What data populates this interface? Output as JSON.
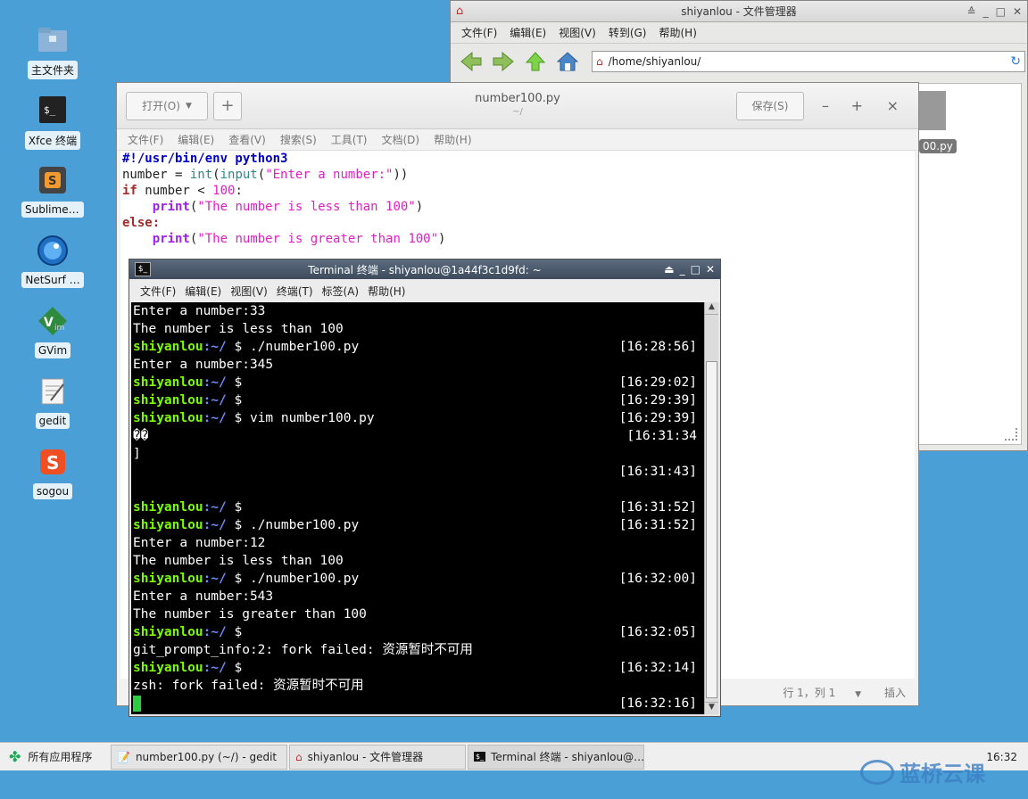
{
  "desktop": {
    "icons": [
      {
        "label": "主文件夹",
        "icon": "folder-icon"
      },
      {
        "label": "Xfce 终端",
        "icon": "terminal-icon"
      },
      {
        "label": "Sublime …",
        "icon": "sublime-icon"
      },
      {
        "label": "NetSurf …",
        "icon": "netsurf-icon"
      },
      {
        "label": "GVim",
        "icon": "gvim-icon"
      },
      {
        "label": "gedit",
        "icon": "gedit-icon"
      },
      {
        "label": "sogou",
        "icon": "sogou-icon"
      }
    ]
  },
  "file_manager": {
    "title": "shiyanlou - 文件管理器",
    "menu": [
      "文件(F)",
      "编辑(E)",
      "视图(V)",
      "转到(G)",
      "帮助(H)"
    ],
    "address": "/home/shiyanlou/",
    "partial_file_label": "00.py"
  },
  "gedit": {
    "open_label": "打开(O)",
    "new_label": "+",
    "title": "number100.py",
    "subtitle": "~/",
    "save_label": "保存(S)",
    "minimize": "–",
    "maximize": "+",
    "close": "×",
    "menu": [
      "文件(F)",
      "编辑(E)",
      "查看(V)",
      "搜索(S)",
      "工具(T)",
      "文档(D)",
      "帮助(H)"
    ],
    "code": {
      "l1": "#!/usr/bin/env python3",
      "l2_var": "number = ",
      "l2_int": "int",
      "l2_input": "input",
      "l2_str": "\"Enter a number:\"",
      "l3_if": "if",
      "l3_mid": " number < ",
      "l3_num": "100",
      "l4_print": "print",
      "l4_str": "\"The number is less than 100\"",
      "l5_else": "else",
      "l6_print": "print",
      "l6_str": "\"The number is greater than 100\""
    },
    "status_position": "行 1，列 1",
    "status_mode": "插入"
  },
  "terminal": {
    "title": "Terminal 终端 - shiyanlou@1a44f3c1d9fd: ~",
    "menu": [
      "文件(F)",
      "编辑(E)",
      "视图(V)",
      "终端(T)",
      "标签(A)",
      "帮助(H)"
    ],
    "user": "shiyanlou",
    "path": ":~/",
    "lines": [
      {
        "text": "Enter a number:33"
      },
      {
        "text": "The number is less than 100"
      },
      {
        "prompt": true,
        "cmd": " $ ./number100.py",
        "time": "[16:28:56]"
      },
      {
        "text": "Enter a number:345"
      },
      {
        "prompt": true,
        "cmd": " $",
        "time": "[16:29:02]"
      },
      {
        "prompt": true,
        "cmd": " $",
        "time": "[16:29:39]"
      },
      {
        "prompt": true,
        "cmd": " $ vim number100.py",
        "time": "[16:29:39]"
      },
      {
        "text": "��",
        "time": "[16:31:34"
      },
      {
        "text": "]"
      },
      {
        "text": "",
        "time": "[16:31:43]"
      },
      {
        "text": ""
      },
      {
        "prompt": true,
        "cmd": " $",
        "time": "[16:31:52]"
      },
      {
        "prompt": true,
        "cmd": " $ ./number100.py",
        "time": "[16:31:52]"
      },
      {
        "text": "Enter a number:12"
      },
      {
        "text": "The number is less than 100"
      },
      {
        "prompt": true,
        "cmd": " $ ./number100.py",
        "time": "[16:32:00]"
      },
      {
        "text": "Enter a number:543"
      },
      {
        "text": "The number is greater than 100"
      },
      {
        "prompt": true,
        "cmd": " $",
        "time": "[16:32:05]"
      },
      {
        "text": "git_prompt_info:2: fork failed: 资源暂时不可用"
      },
      {
        "prompt": true,
        "cmd": " $",
        "time": "[16:32:14]"
      },
      {
        "text": "zsh: fork failed: 资源暂时不可用"
      },
      {
        "cursor": true,
        "time": "[16:32:16]"
      }
    ]
  },
  "taskbar": {
    "apps_label": "所有应用程序",
    "tasks": [
      {
        "label": "number100.py (~/) - gedit",
        "icon": "gedit-icon"
      },
      {
        "label": "shiyanlou - 文件管理器",
        "icon": "home-icon"
      },
      {
        "label": "Terminal 终端 - shiyanlou@…",
        "icon": "terminal-icon"
      }
    ],
    "clock": "16:32"
  },
  "watermark": "蓝桥云课"
}
